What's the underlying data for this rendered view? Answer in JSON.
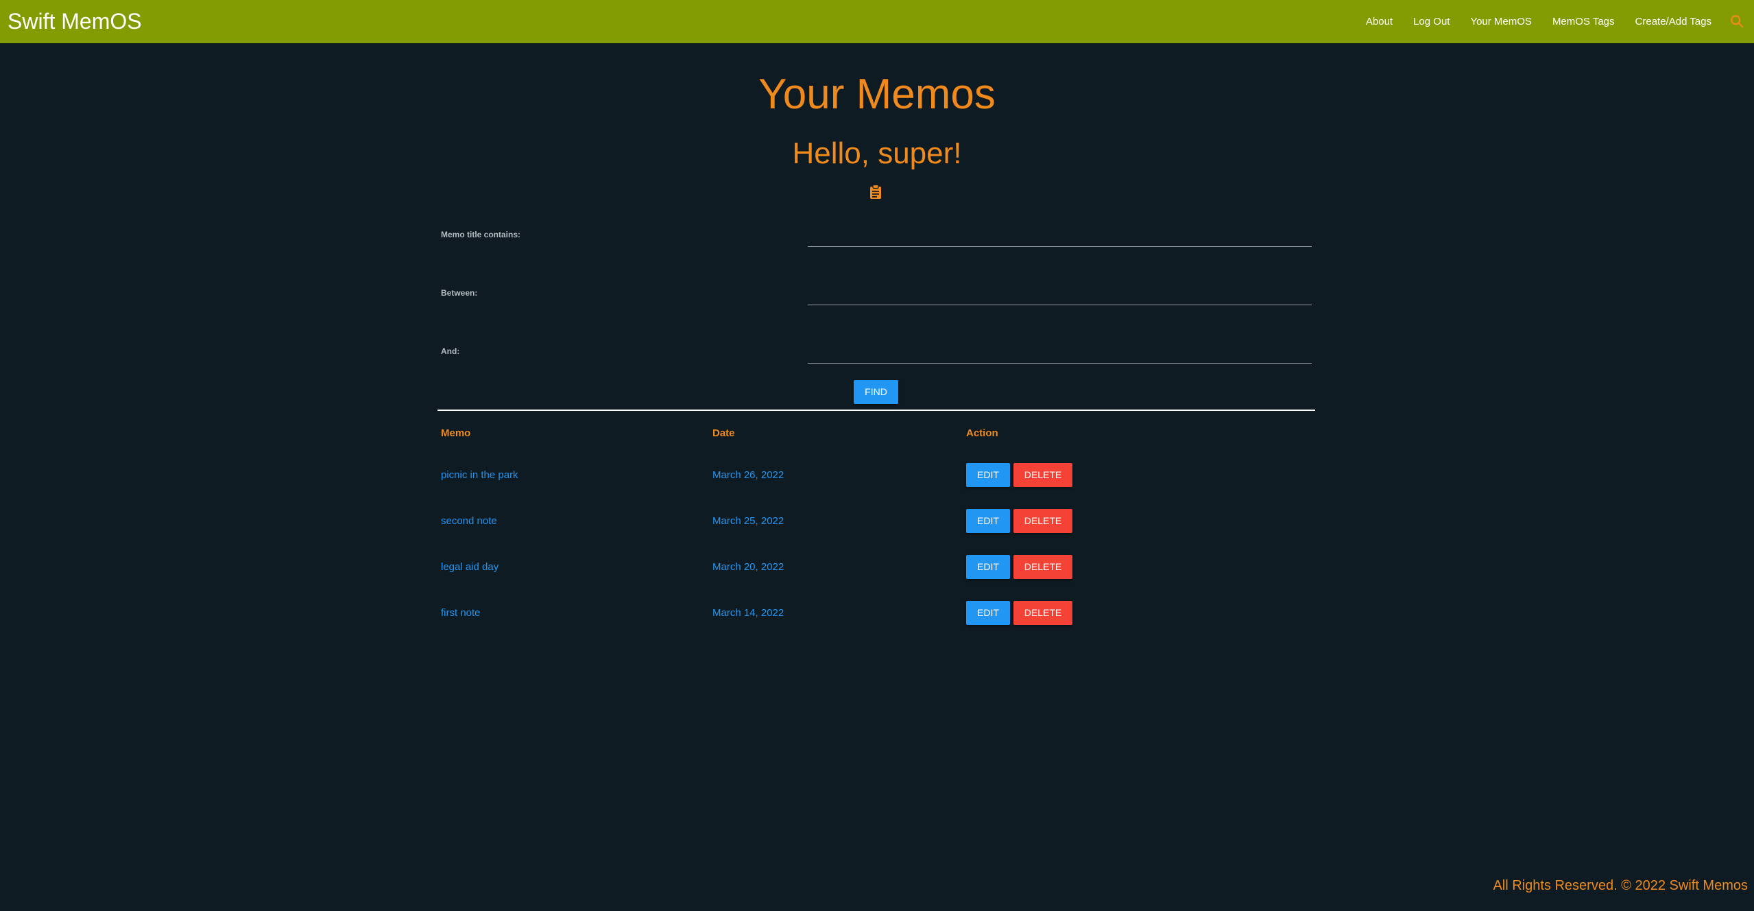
{
  "navbar": {
    "brand": "Swift MemOS",
    "links": [
      "About",
      "Log Out",
      "Your MemOS",
      "MemOS Tags",
      "Create/Add Tags"
    ],
    "search_icon": "search-icon"
  },
  "page": {
    "title": "Your Memos",
    "greeting": "Hello, super!",
    "icon": "clipboard-icon"
  },
  "search_form": {
    "title_label": "Memo title contains:",
    "title_value": "",
    "between_label": "Between:",
    "between_value": "",
    "and_label": "And:",
    "and_value": "",
    "find_label": "FIND"
  },
  "table": {
    "headers": [
      "Memo",
      "Date",
      "Action"
    ],
    "rows": [
      {
        "memo": "picnic in the park",
        "date": "March 26, 2022"
      },
      {
        "memo": "second note",
        "date": "March 25, 2022"
      },
      {
        "memo": "legal aid day",
        "date": "March 20, 2022"
      },
      {
        "memo": "first note",
        "date": "March 14, 2022"
      }
    ],
    "edit_label": "EDIT",
    "delete_label": "DELETE"
  },
  "footer": {
    "text": "All Rights Reserved. © 2022 Swift Memos"
  },
  "colors": {
    "navbar": "#839c02",
    "background": "#0e1b22",
    "accent": "#f18a1c",
    "link": "#2196f3",
    "danger": "#f44336"
  }
}
